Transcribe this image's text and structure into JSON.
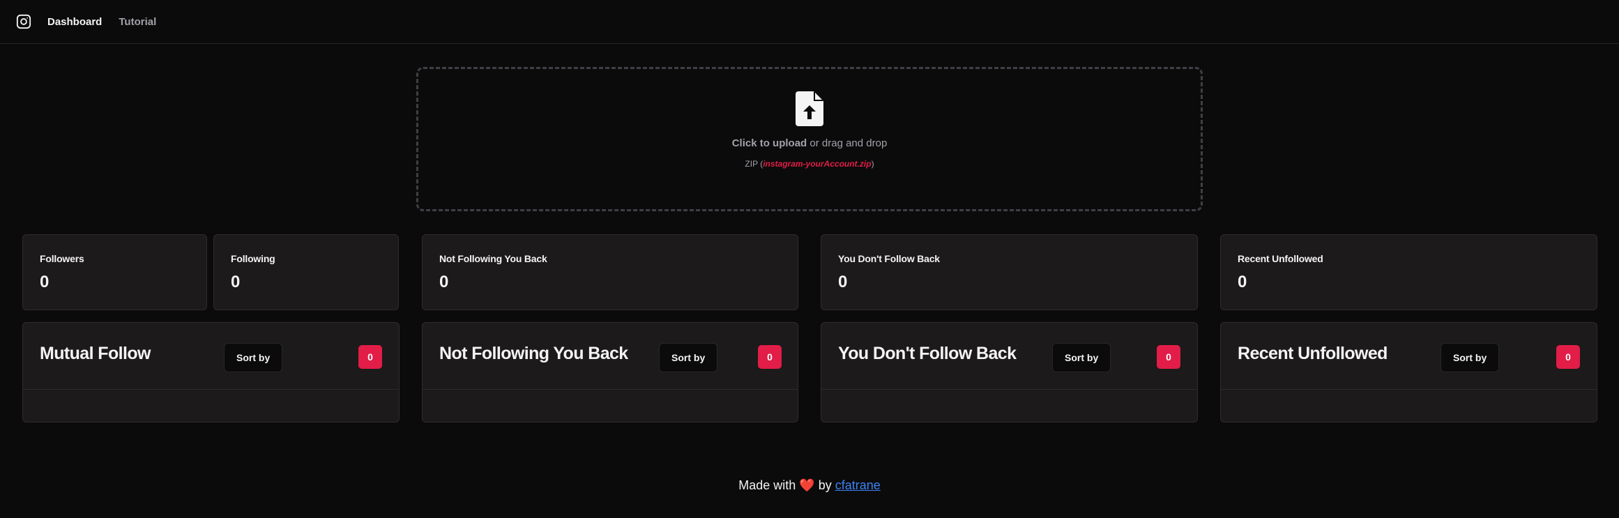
{
  "nav": {
    "logo_icon": "instagram-icon",
    "links": [
      {
        "label": "Dashboard",
        "active": true
      },
      {
        "label": "Tutorial",
        "active": false
      }
    ]
  },
  "upload": {
    "icon": "file-upload-icon",
    "cta": "Click to upload",
    "rest": " or drag and drop",
    "format_prefix": "ZIP (",
    "format_file": "instagram-yourAccount.zip",
    "format_suffix": ")"
  },
  "stats": {
    "followers": {
      "label": "Followers",
      "value": "0"
    },
    "following": {
      "label": "Following",
      "value": "0"
    },
    "not_following_back": {
      "label": "Not Following You Back",
      "value": "0"
    },
    "you_dont_follow_back": {
      "label": "You Don't Follow Back",
      "value": "0"
    },
    "recent_unfollowed": {
      "label": "Recent Unfollowed",
      "value": "0"
    }
  },
  "lists": {
    "mutual": {
      "title": "Mutual Follow",
      "sort_label": "Sort by",
      "count": "0"
    },
    "not_following_back": {
      "title": "Not Following You Back",
      "sort_label": "Sort by",
      "count": "0"
    },
    "you_dont_follow_back": {
      "title": "You Don't Follow Back",
      "sort_label": "Sort by",
      "count": "0"
    },
    "recent_unfollowed": {
      "title": "Recent Unfollowed",
      "sort_label": "Sort by",
      "count": "0"
    }
  },
  "footer": {
    "prefix": "Made with ",
    "heart": "❤️",
    "by": " by ",
    "author": "cfatrane"
  },
  "colors": {
    "background": "#0c0b0b",
    "card": "#1c1a1a",
    "accent": "#e11d48",
    "link": "#3b82f6"
  }
}
